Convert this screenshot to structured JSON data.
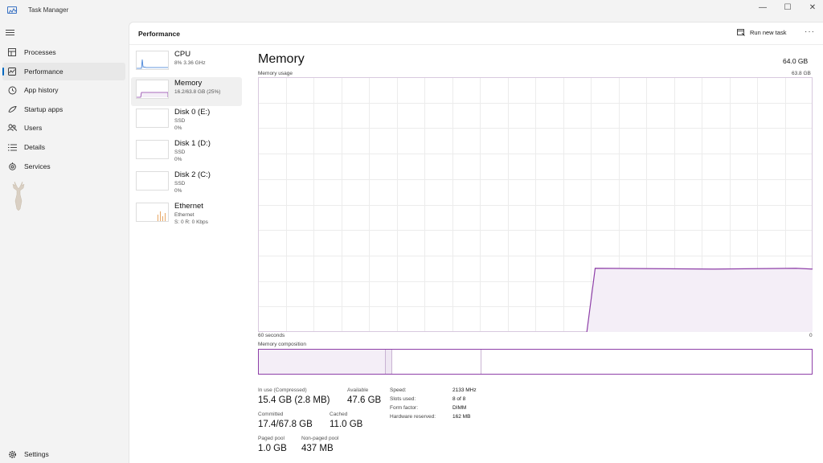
{
  "window": {
    "title": "Task Manager",
    "minimize": "—",
    "maximize": "☐",
    "close": "✕"
  },
  "nav": {
    "items": [
      {
        "label": "Processes",
        "icon": "processes-icon"
      },
      {
        "label": "Performance",
        "icon": "performance-icon",
        "active": true
      },
      {
        "label": "App history",
        "icon": "app-history-icon"
      },
      {
        "label": "Startup apps",
        "icon": "startup-apps-icon"
      },
      {
        "label": "Users",
        "icon": "users-icon"
      },
      {
        "label": "Details",
        "icon": "details-icon"
      },
      {
        "label": "Services",
        "icon": "services-icon"
      }
    ],
    "settings": "Settings"
  },
  "header": {
    "title": "Performance",
    "run_new_task": "Run new task",
    "more": "···"
  },
  "devices": [
    {
      "name": "CPU",
      "line1": "8% 3.36 GHz",
      "line2": ""
    },
    {
      "name": "Memory",
      "line1": "16.2/63.8 GB (25%)",
      "line2": ""
    },
    {
      "name": "Disk 0 (E:)",
      "line1": "SSD",
      "line2": "0%"
    },
    {
      "name": "Disk 1 (D:)",
      "line1": "SSD",
      "line2": "0%"
    },
    {
      "name": "Disk 2 (C:)",
      "line1": "SSD",
      "line2": "0%"
    },
    {
      "name": "Ethernet",
      "line1": "Ethernet",
      "line2": "S: 0 R: 0 Kbps"
    }
  ],
  "memory": {
    "title": "Memory",
    "total": "64.0 GB",
    "usage_label": "Memory usage",
    "usage_max": "63.8 GB",
    "graph_left": "60 seconds",
    "graph_right": "0",
    "composition_label": "Memory composition",
    "stats": {
      "in_use_label": "In use (Compressed)",
      "in_use_value": "15.4 GB (2.8 MB)",
      "available_label": "Available",
      "available_value": "47.6 GB",
      "committed_label": "Committed",
      "committed_value": "17.4/67.8 GB",
      "cached_label": "Cached",
      "cached_value": "11.0 GB",
      "paged_label": "Paged pool",
      "paged_value": "1.0 GB",
      "nonpaged_label": "Non-paged pool",
      "nonpaged_value": "437 MB"
    },
    "specs": {
      "speed_label": "Speed:",
      "speed_value": "2133 MHz",
      "slots_label": "Slots used:",
      "slots_value": "8 of 8",
      "form_label": "Form factor:",
      "form_value": "DIMM",
      "hw_label": "Hardware reserved:",
      "hw_value": "162 MB"
    },
    "usage_fraction": 0.25,
    "composition_in_use_fraction": 0.243,
    "composition_cached_fraction": 0.159,
    "accent": "#8e3fa8",
    "fill": "#f4eef7"
  }
}
